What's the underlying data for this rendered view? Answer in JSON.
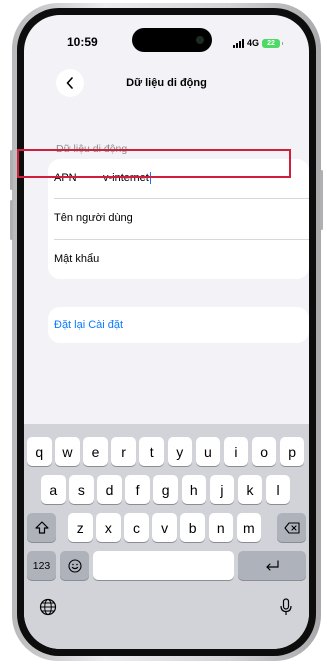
{
  "status_bar": {
    "time": "10:59",
    "network": "4G",
    "battery": "22"
  },
  "nav": {
    "title": "Dữ liệu di động",
    "back_icon": "chevron-left-icon"
  },
  "section_header": "Dữ liệu di động",
  "fields": [
    {
      "label": "APN",
      "value": "v-internet"
    },
    {
      "label": "Tên người dùng",
      "value": ""
    },
    {
      "label": "Mật khẩu",
      "value": ""
    }
  ],
  "reset_label": "Đặt lại Cài đặt",
  "keyboard": {
    "row1": [
      "q",
      "w",
      "e",
      "r",
      "t",
      "y",
      "u",
      "i",
      "o",
      "p"
    ],
    "row2": [
      "a",
      "s",
      "d",
      "f",
      "g",
      "h",
      "j",
      "k",
      "l"
    ],
    "row3": [
      "z",
      "x",
      "c",
      "v",
      "b",
      "n",
      "m"
    ],
    "numbers_label": "123",
    "icons": {
      "shift": "shift-icon",
      "delete": "delete-icon",
      "emoji": "emoji-icon",
      "return": "return-icon",
      "globe": "globe-icon",
      "mic": "microphone-icon"
    }
  },
  "colors": {
    "highlight": "#d11f3b",
    "link": "#0a7aff",
    "battery": "#4cd964"
  }
}
